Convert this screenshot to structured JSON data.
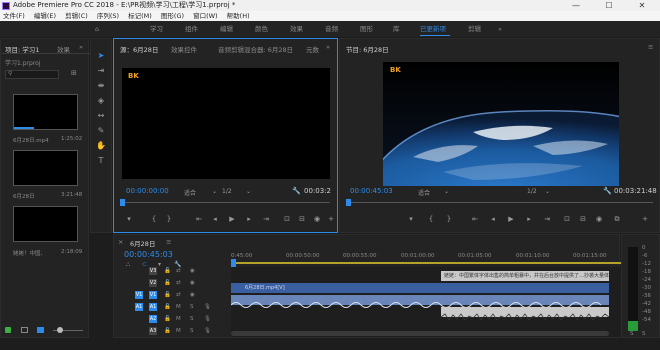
{
  "window": {
    "title": "Adobe Premiere Pro CC 2018 - E:\\PR视频\\学习\\工程\\学习1.prproj *"
  },
  "menu": [
    "文件(F)",
    "编辑(E)",
    "剪辑(C)",
    "序列(S)",
    "标记(M)",
    "图形(G)",
    "窗口(W)",
    "帮助(H)"
  ],
  "workspaces": [
    "学习",
    "组件",
    "编辑",
    "颜色",
    "效果",
    "音频",
    "图形",
    "库",
    "已更新项",
    "剪辑"
  ],
  "active_workspace": "已更新项",
  "project": {
    "tabs": [
      "项目: 学习1",
      "效果"
    ],
    "name": "学习1.prproj",
    "items": [
      {
        "name": "6月28日.mp4",
        "duration": "1:25:02"
      },
      {
        "name": "6月28日",
        "duration": "3:21:48"
      },
      {
        "name": "姥姥！中国、",
        "duration": "2:18:09"
      }
    ]
  },
  "source": {
    "tabs": [
      "源：6月28日",
      "效果控件",
      "音频剪辑混合器: 6月28日",
      "元数"
    ],
    "overlay": "BK",
    "timecode": "00:00:00:00",
    "fit": "适合",
    "res": "1/2",
    "end_timecode": "00:03:2"
  },
  "program": {
    "tab": "节目: 6月28日",
    "overlay": "BK",
    "timecode": "00:00:45:03",
    "fit": "适合",
    "res": "1/2",
    "end_timecode": "00:03:21:48"
  },
  "timeline": {
    "tab": "6月28日",
    "timecode": "00:00:45:03",
    "ruler": [
      "0:45:00",
      "00:00:50:00",
      "00:00:55:00",
      "00:01:00:00",
      "00:01:05:00",
      "00:01:10:00",
      "00:01:15:00"
    ],
    "tracks": [
      {
        "id": "V3",
        "kind": "video"
      },
      {
        "id": "V2",
        "kind": "video"
      },
      {
        "id": "V1",
        "kind": "video"
      },
      {
        "id": "A1",
        "kind": "audio"
      },
      {
        "id": "A2",
        "kind": "audio"
      },
      {
        "id": "A3",
        "kind": "audio"
      }
    ],
    "clip_title": "6月28日.mp4[V]",
    "caption_clip": "姥姥：中国繁体字体出售的简单粗暴中，并在后台放中提供了…抄袭大量体会了么么",
    "audio_meter": {
      "scale": [
        "0",
        "-6",
        "-12",
        "-18",
        "-24",
        "-30",
        "-36",
        "-42",
        "-48",
        "-54"
      ]
    }
  },
  "colors": {
    "accent": "#2d8ceb",
    "panel": "#232323",
    "bg": "#1d1d1d",
    "video_clip": "#3a5fa0",
    "audio_clip": "#6a86b8",
    "caption": "#c9c9c9"
  }
}
